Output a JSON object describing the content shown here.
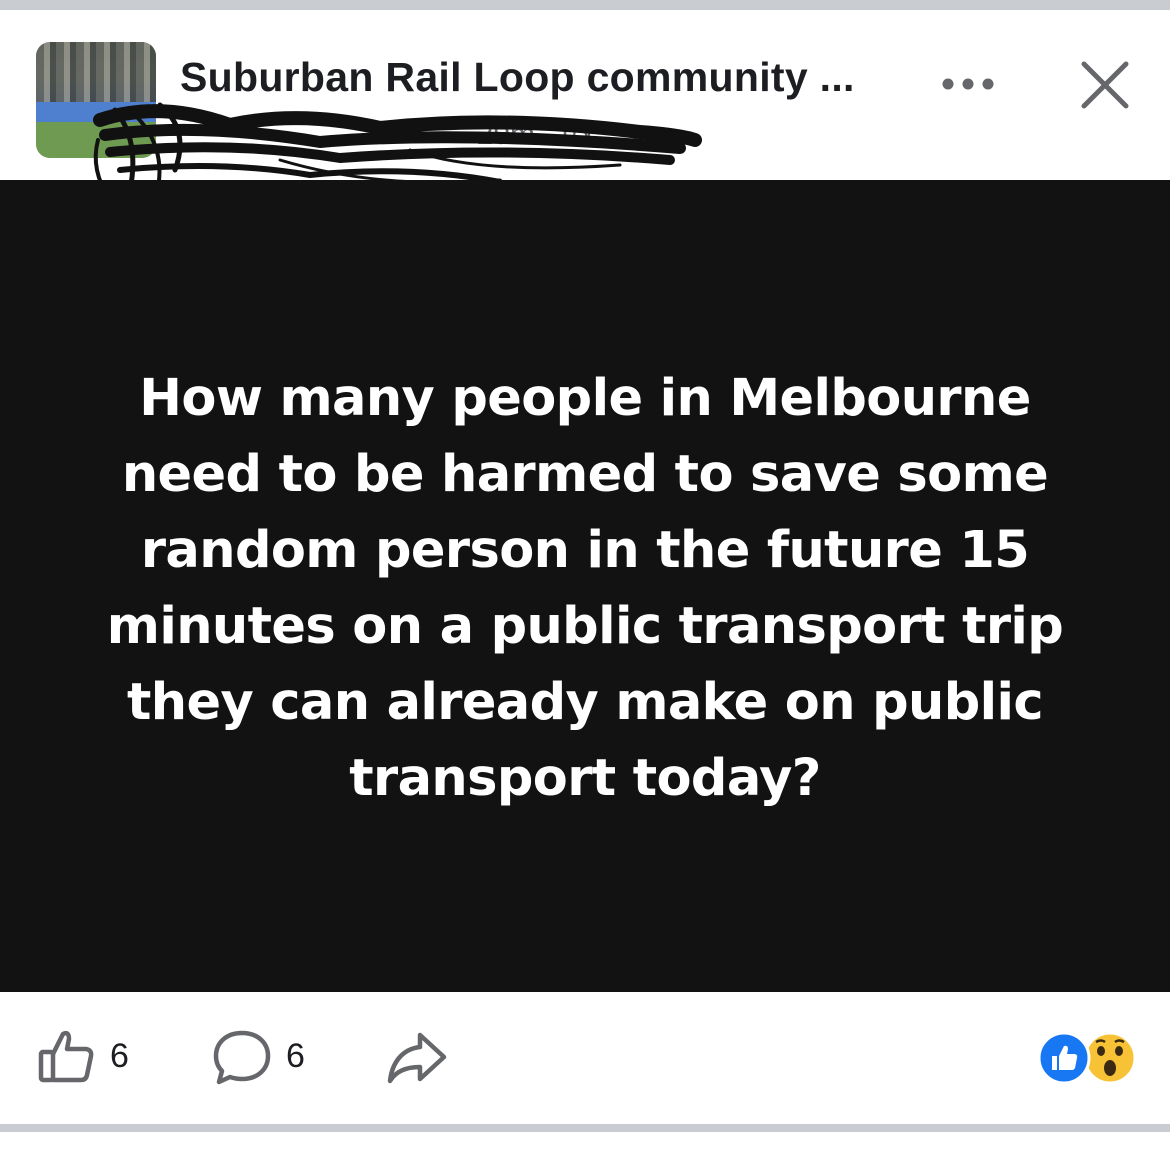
{
  "header": {
    "group_title": "Suburban Rail Loop community ...",
    "meta_time": "29m",
    "meta_separator": "·"
  },
  "post": {
    "text": "How many people in Melbourne need to be harmed to save some random person in the future 15 minutes on a public transport trip they can already make on public transport today?"
  },
  "actions": {
    "like_count": "6",
    "comment_count": "6"
  },
  "icons": {
    "more": "more-dots-icon",
    "close": "close-icon",
    "privacy": "globe-icon",
    "like": "thumbs-up-icon",
    "comment": "comment-bubble-icon",
    "share": "share-arrow-icon",
    "reactions": [
      "like-reaction-icon",
      "wow-reaction-icon"
    ]
  },
  "colors": {
    "post_background": "#121212",
    "post_text": "#ffffff",
    "like_blue": "#1877f2",
    "wow_yellow": "#f7c236"
  }
}
